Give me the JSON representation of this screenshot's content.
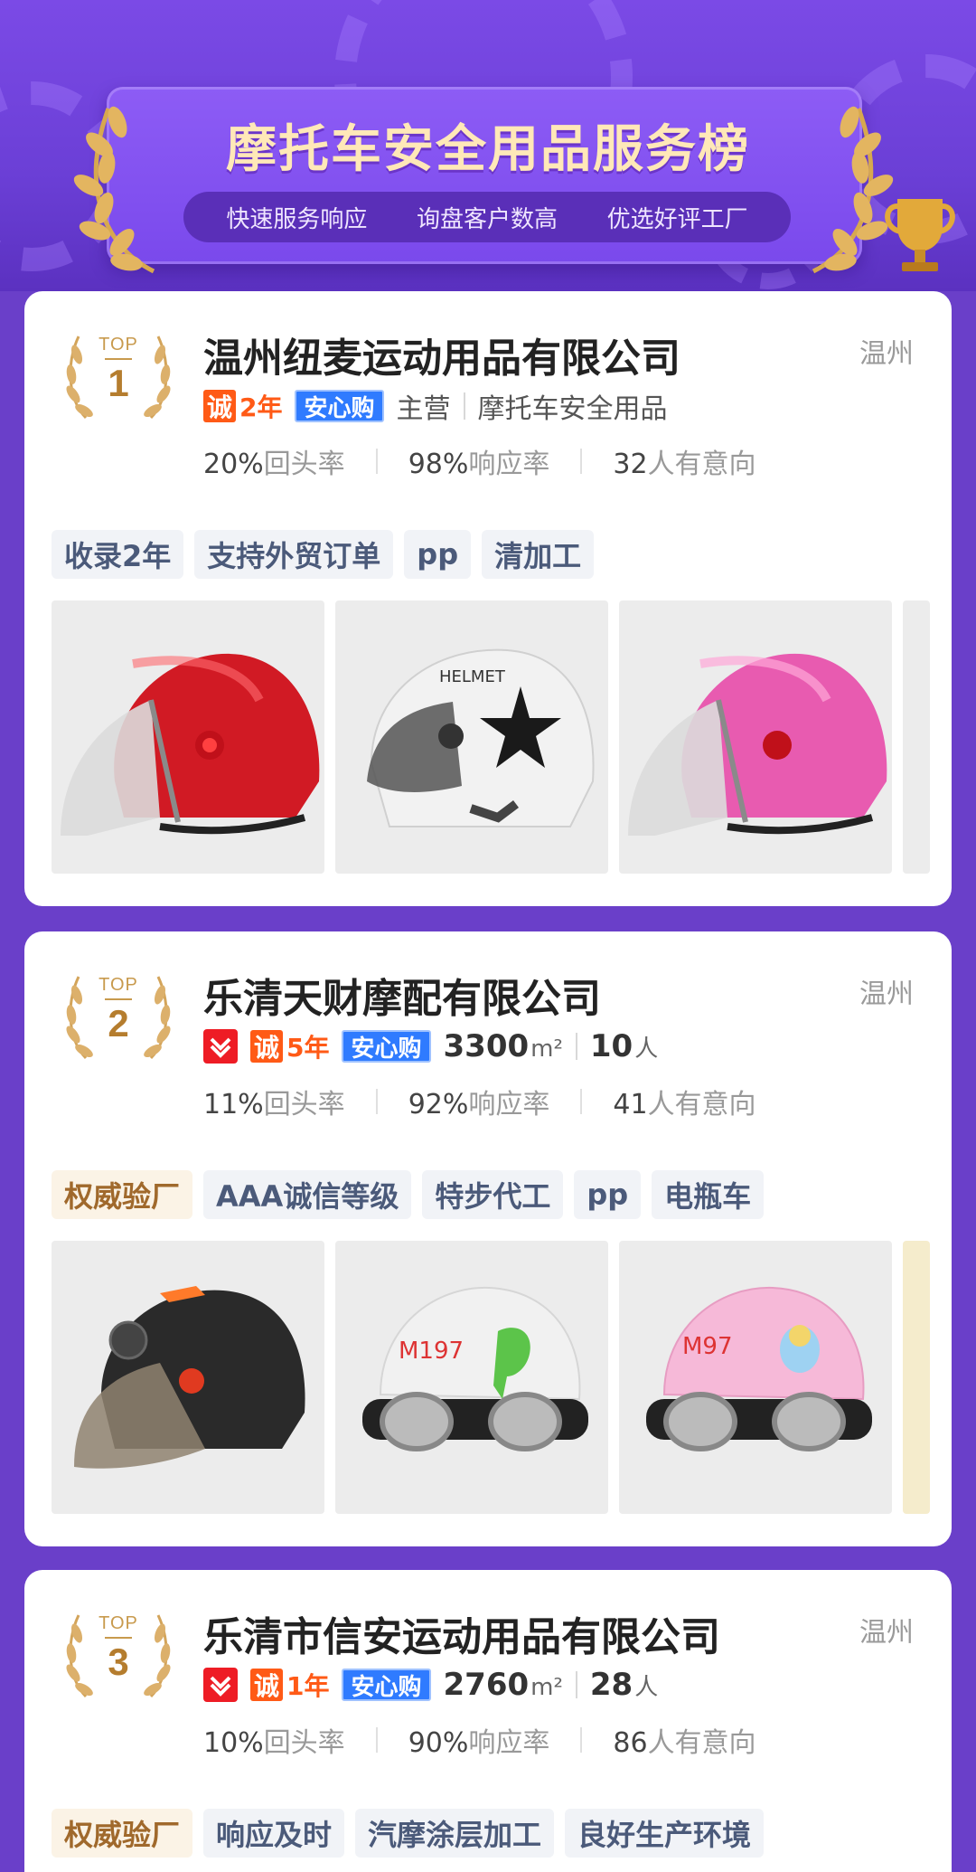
{
  "banner": {
    "title": "摩托车安全用品服务榜",
    "features": [
      "快速服务响应",
      "询盘客户数高",
      "优选好评工厂"
    ]
  },
  "colors": {
    "background": "#6a3fc9",
    "title_gold": "#ffe8b8",
    "cheng_orange": "#ff5a16",
    "anxin_blue": "#2f7bff",
    "rank_gold": "#b57d2e"
  },
  "companies": [
    {
      "rank_top": "TOP",
      "rank": "1",
      "name": "温州纽麦运动用品有限公司",
      "city": "温州",
      "cheng_icon": "诚",
      "cheng_years": "2年",
      "anxin": "安心购",
      "main_label": "主营",
      "main_business": "摩托车安全用品",
      "return_rate": "20%",
      "return_label": "回头率",
      "response_rate": "98%",
      "response_label": "响应率",
      "intent_count": "32",
      "intent_label": "人有意向",
      "chips": [
        "收录2年",
        "支持外贸订单",
        "pp",
        "清加工"
      ],
      "products": [
        "red-helmet-icon",
        "white-star-helmet-icon",
        "pink-helmet-icon"
      ]
    },
    {
      "rank_top": "TOP",
      "rank": "2",
      "name": "乐清天财摩配有限公司",
      "city": "温州",
      "cheng_icon": "诚",
      "cheng_years": "5年",
      "anxin": "安心购",
      "area": "3300",
      "area_unit": "m²",
      "staff": "10",
      "staff_unit": "人",
      "return_rate": "11%",
      "return_label": "回头率",
      "response_rate": "92%",
      "response_label": "响应率",
      "intent_count": "41",
      "intent_label": "人有意向",
      "chips": [
        "权威验厂",
        "AAA诚信等级",
        "特步代工",
        "pp",
        "电瓶车"
      ],
      "products": [
        "black-helmet-icon",
        "dino-goggle-helmet-icon",
        "pink-goggle-helmet-icon"
      ]
    },
    {
      "rank_top": "TOP",
      "rank": "3",
      "name": "乐清市信安运动用品有限公司",
      "city": "温州",
      "cheng_icon": "诚",
      "cheng_years": "1年",
      "anxin": "安心购",
      "area": "2760",
      "area_unit": "m²",
      "staff": "28",
      "staff_unit": "人",
      "return_rate": "10%",
      "return_label": "回头率",
      "response_rate": "90%",
      "response_label": "响应率",
      "intent_count": "86",
      "intent_label": "人有意向",
      "chips": [
        "权威验厂",
        "响应及时",
        "汽摩涂层加工",
        "良好生产环境"
      ]
    }
  ]
}
